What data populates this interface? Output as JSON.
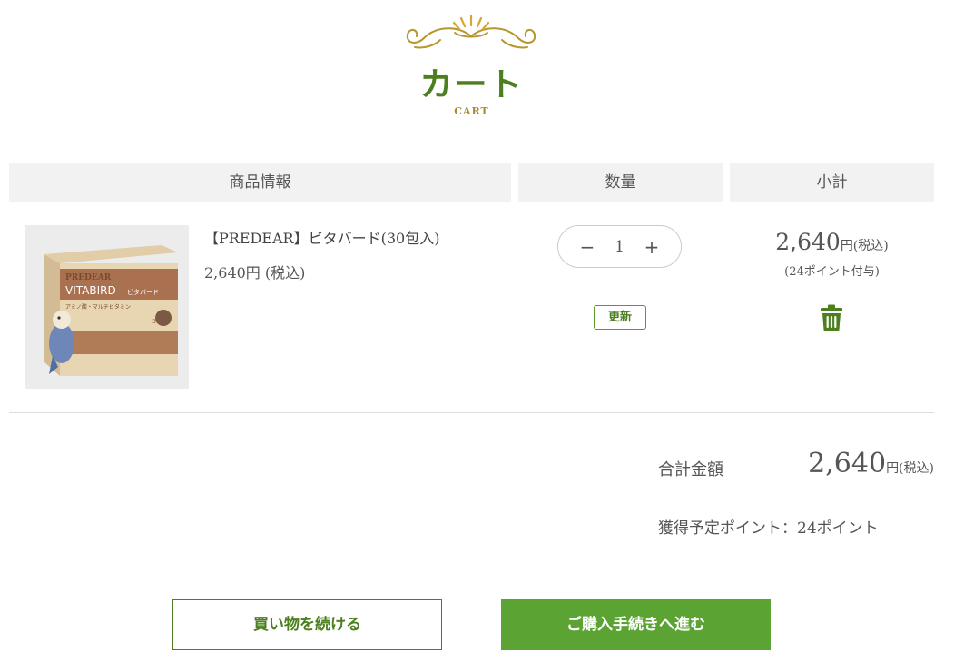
{
  "header": {
    "title": "カート",
    "subtitle": "CART"
  },
  "table": {
    "columns": {
      "product": "商品情報",
      "quantity": "数量",
      "subtotal": "小計"
    }
  },
  "item": {
    "name": "【PREDEAR】ビタバード(30包入)",
    "price": "2,640円 (税込)",
    "quantity": "1",
    "update_label": "更新",
    "subtotal_amount": "2,640",
    "subtotal_unit": "円(税込)",
    "points": "(24ポイント付与)",
    "image": {
      "brand": "PREDEAR",
      "product": "VITABIRD",
      "product_jp": "ビタバード",
      "sub": "アミノ酸・マルチビタミン",
      "count": "30包入"
    }
  },
  "summary": {
    "total_label": "合計金額",
    "total_amount": "2,640",
    "total_unit": "円(税込)",
    "points_label": "獲得予定ポイント：24ポイント"
  },
  "actions": {
    "continue_label": "買い物を続ける",
    "checkout_label": "ご購入手続きへ進む"
  },
  "colors": {
    "accent_green": "#5ba434",
    "title_green": "#4c7f1f",
    "gold": "#a88a2c",
    "header_gray": "#f2f2f2"
  }
}
